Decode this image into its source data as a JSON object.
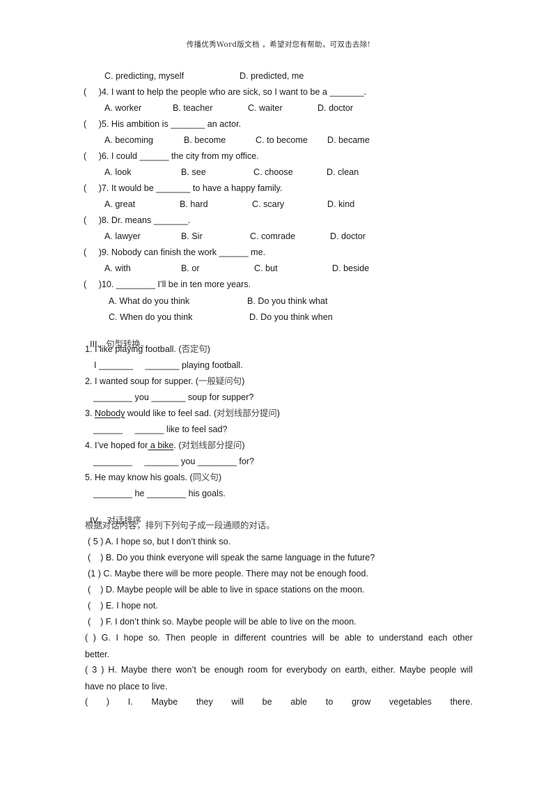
{
  "header": {
    "text": "传播优秀Word版文档 ，希望对您有帮助，可双击去除!"
  },
  "part2": {
    "q3_options_cd": {
      "c": "C. predicting, myself",
      "d": "D. predicted, me"
    },
    "questions": [
      {
        "stem": "(     )4. I want to help the people who are sick, so I want to be a _______.",
        "options": [
          "A. worker",
          "B. teacher",
          "C. waiter",
          "D. doctor"
        ]
      },
      {
        "stem": "(     )5. His ambition is _______ an actor.",
        "options": [
          "A. becoming",
          "B. become",
          "C. to become",
          "D. became"
        ]
      },
      {
        "stem": "(     )6. I could ______ the city from my office.",
        "options": [
          "A. look",
          "B. see",
          "C. choose",
          "D. clean"
        ]
      },
      {
        "stem": "(     )7. It would be _______ to have a happy family.",
        "options": [
          "A. great",
          "B. hard",
          "C. scary",
          "D. kind"
        ]
      },
      {
        "stem": "(     )8. Dr. means _______.",
        "options": [
          "A. lawyer",
          "B. Sir",
          "C. comrade",
          "D. doctor"
        ]
      },
      {
        "stem": "(     )9. Nobody can finish the work ______ me.",
        "options": [
          "A. with",
          "B. or",
          "C. but",
          "D. beside"
        ]
      },
      {
        "stem": "(     )10. ________ I’ll be in ten more years.",
        "options": [
          "A. What do you think",
          "B. Do you think what",
          "C. When do you think",
          "D. Do you think when"
        ]
      }
    ]
  },
  "part3": {
    "title_roman": "III、",
    "title_cn": "句型转换。",
    "items": [
      {
        "pre": "1. I like playing football. (",
        "under": "",
        "post": "",
        "hint": "否定句",
        "close": ")",
        "answer": "I _______     _______ playing football."
      },
      {
        "pre": "2. I wanted soup for supper. (",
        "under": "",
        "post": "",
        "hint": "一般疑问句",
        "close": ")",
        "answer": "________ you _______ soup for supper?"
      },
      {
        "pre": "3. ",
        "under": "Nobody",
        "post": " would like to feel sad. (",
        "hint": "对划线部分提问",
        "close": ")",
        "answer": "______     ______ like to feel sad?"
      },
      {
        "pre": "4. I’ve hoped for",
        "under": " a bike",
        "post": ". (",
        "hint": "对划线部分提问",
        "close": ")",
        "answer": "________     _______ you ________ for?"
      },
      {
        "pre": "5. He may know his goals. (",
        "under": "",
        "post": "",
        "hint": "同义句",
        "close": ")",
        "answer": "________ he ________ his goals."
      }
    ]
  },
  "part4": {
    "title_roman": "IV、",
    "title_cn": "对话排序",
    "instruction": "根据对话内容，排列下列句子成一段通顺的对话。",
    "lines": [
      "( 5 ) A. I hope so, but I don’t think so.",
      "(    ) B. Do you think everyone will speak the same language in the future?",
      "(1 ) C. Maybe there will be more people. There may not be enough food.",
      "(    ) D. Maybe people will be able to live in space stations on the moon.",
      "(    ) E. I hope not.",
      "(    ) F. I don’t think so. Maybe people will be able to live on the moon."
    ],
    "g_words": [
      "(",
      ")",
      "G.",
      "I",
      "hope",
      "so.",
      "Then",
      "people",
      "in",
      "different",
      "countries",
      "will",
      "be",
      "able",
      "to",
      "understand",
      "each",
      "other"
    ],
    "g_cont": "better.",
    "h_words": [
      "(",
      "3",
      ")",
      "H.",
      "Maybe",
      "there",
      "won’t",
      "be",
      "enough",
      "room",
      "for",
      "everybody",
      "on",
      "earth,",
      "either.",
      "Maybe",
      "people",
      "will"
    ],
    "h_cont": "have no place to live.",
    "i_words": [
      "(",
      ")",
      "I.",
      "Maybe",
      "they",
      "will",
      "be",
      "able",
      "to",
      "grow",
      "vegetables",
      "there."
    ]
  }
}
